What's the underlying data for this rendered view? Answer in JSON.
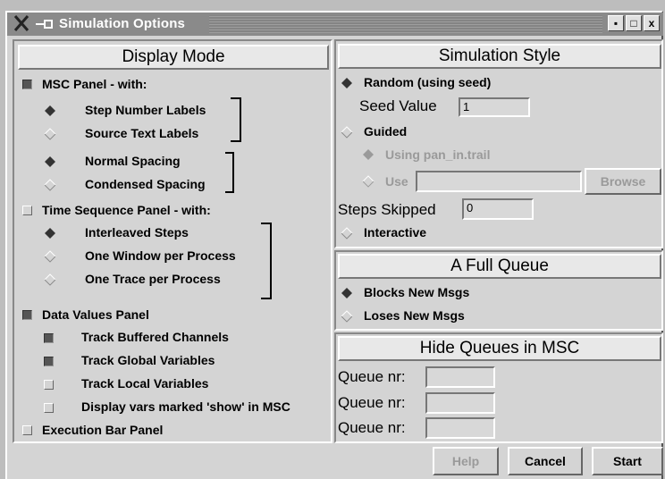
{
  "window": {
    "title": "Simulation Options",
    "controls": [
      "▪",
      "□",
      "x"
    ]
  },
  "display_mode": {
    "header": "Display Mode",
    "msc_panel": {
      "label": "MSC Panel - with:",
      "checked": true
    },
    "step_number_labels": {
      "label": "Step Number Labels",
      "selected": true
    },
    "source_text_labels": {
      "label": "Source Text Labels",
      "selected": false
    },
    "normal_spacing": {
      "label": "Normal Spacing",
      "selected": true
    },
    "condensed_spacing": {
      "label": "Condensed Spacing",
      "selected": false
    },
    "time_sequence_panel": {
      "label": "Time Sequence Panel - with:",
      "checked": false
    },
    "interleaved_steps": {
      "label": "Interleaved Steps",
      "selected": true
    },
    "one_window_per_process": {
      "label": "One Window per Process",
      "selected": false
    },
    "one_trace_per_process": {
      "label": "One Trace per Process",
      "selected": false
    },
    "data_values_panel": {
      "label": "Data Values Panel",
      "checked": true
    },
    "track_buffered_channels": {
      "label": "Track Buffered Channels",
      "checked": true
    },
    "track_global_variables": {
      "label": "Track Global Variables",
      "checked": true
    },
    "track_local_variables": {
      "label": "Track Local Variables",
      "checked": false
    },
    "display_vars_show": {
      "label": "Display vars marked 'show' in MSC",
      "checked": false
    },
    "execution_bar_panel": {
      "label": "Execution Bar Panel",
      "checked": false
    }
  },
  "simulation_style": {
    "header": "Simulation Style",
    "random": {
      "label": "Random (using seed)",
      "selected": true
    },
    "seed_value": {
      "label": "Seed Value",
      "value": "1"
    },
    "guided": {
      "label": "Guided",
      "selected": false
    },
    "using_trail": {
      "label": "Using pan_in.trail",
      "selected": true
    },
    "use": {
      "label": "Use",
      "value": "",
      "selected": false
    },
    "browse_label": "Browse",
    "steps_skipped": {
      "label": "Steps Skipped",
      "value": "0"
    },
    "interactive": {
      "label": "Interactive",
      "selected": false
    }
  },
  "full_queue": {
    "header": "A Full Queue",
    "blocks": {
      "label": "Blocks New Msgs",
      "selected": true
    },
    "loses": {
      "label": "Loses New Msgs",
      "selected": false
    }
  },
  "hide_queues": {
    "header": "Hide Queues in MSC",
    "queue_label": "Queue nr:",
    "queues": [
      "",
      "",
      ""
    ]
  },
  "footer": {
    "help_label": "Help",
    "cancel_label": "Cancel",
    "start_label": "Start"
  }
}
